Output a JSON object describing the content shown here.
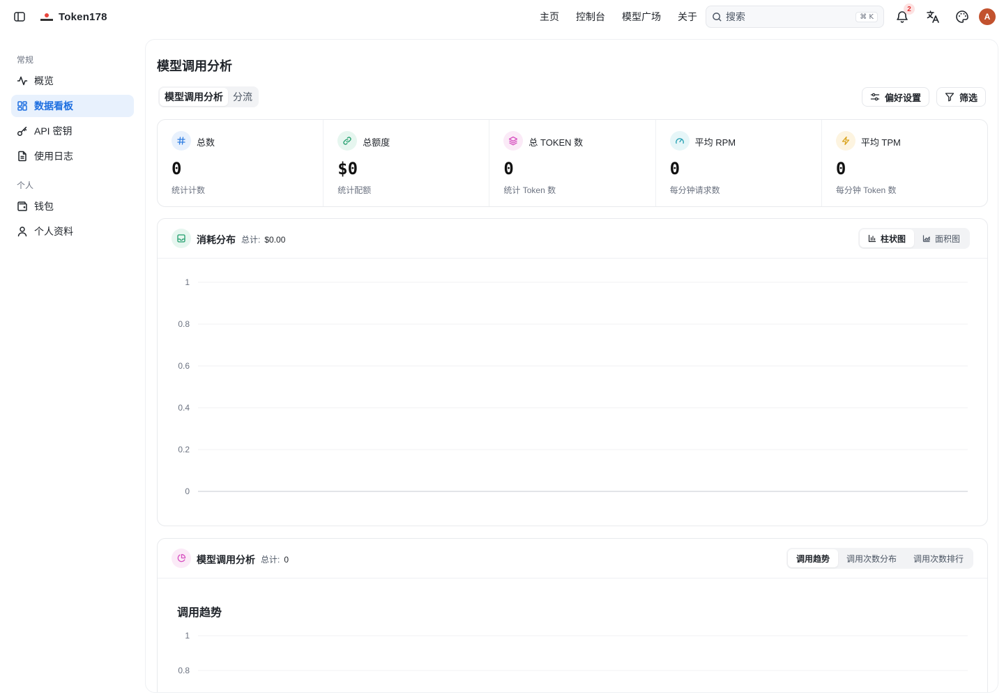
{
  "header": {
    "brand": "Token178",
    "nav": [
      "主页",
      "控制台",
      "模型广场",
      "关于"
    ],
    "search_placeholder": "搜索",
    "search_shortcut": "⌘ K",
    "notification_count": "2",
    "avatar_initial": "A"
  },
  "sidebar": {
    "sections": [
      {
        "title": "常规",
        "items": [
          {
            "label": "概览",
            "icon": "activity-icon",
            "active": false
          },
          {
            "label": "数据看板",
            "icon": "dashboard-icon",
            "active": true
          },
          {
            "label": "API 密钥",
            "icon": "key-icon",
            "active": false
          },
          {
            "label": "使用日志",
            "icon": "file-text-icon",
            "active": false
          }
        ]
      },
      {
        "title": "个人",
        "items": [
          {
            "label": "钱包",
            "icon": "wallet-icon",
            "active": false
          },
          {
            "label": "个人资料",
            "icon": "user-icon",
            "active": false
          }
        ]
      }
    ]
  },
  "main": {
    "title": "模型调用分析",
    "segments": [
      "模型调用分析",
      "分流"
    ],
    "active_segment": 0,
    "preferences_label": "偏好设置",
    "filter_label": "筛选",
    "stats": [
      {
        "label": "总数",
        "value": "0",
        "sub": "统计计数",
        "icon": "hash-icon",
        "color": "#2f7de1",
        "bg": "#e8f1fd"
      },
      {
        "label": "总额度",
        "value": "$0",
        "sub": "统计配额",
        "icon": "link-icon",
        "color": "#1f9d6b",
        "bg": "#e6f6ef"
      },
      {
        "label": "总 TOKEN 数",
        "value": "0",
        "sub": "统计 Token 数",
        "icon": "layers-icon",
        "color": "#d64fbf",
        "bg": "#fbeaf7"
      },
      {
        "label": "平均 RPM",
        "value": "0",
        "sub": "每分钟请求数",
        "icon": "gauge-icon",
        "color": "#1f9db0",
        "bg": "#e6f6f8"
      },
      {
        "label": "平均 TPM",
        "value": "0",
        "sub": "每分钟 Token 数",
        "icon": "zap-icon",
        "color": "#d9a21b",
        "bg": "#fdf4e0"
      }
    ],
    "consumption": {
      "title": "消耗分布",
      "total_label": "总计:",
      "total_value": "$0.00",
      "tabs": [
        "柱状图",
        "面积图"
      ],
      "active_tab": 0
    },
    "model_analysis": {
      "title": "模型调用分析",
      "total_label": "总计:",
      "total_value": "0",
      "tabs": [
        "调用趋势",
        "调用次数分布",
        "调用次数排行"
      ],
      "active_tab": 0,
      "subtitle": "调用趋势"
    }
  },
  "chart_data": [
    {
      "type": "bar",
      "title": "消耗分布",
      "categories": [],
      "series": [],
      "yticks": [
        "1",
        "0.8",
        "0.6",
        "0.4",
        "0.2",
        "0"
      ],
      "ylim": [
        0,
        1
      ],
      "grid": true
    },
    {
      "type": "line",
      "title": "调用趋势",
      "categories": [],
      "series": [],
      "yticks": [
        "1",
        "0.8"
      ],
      "ylim": [
        0,
        1
      ],
      "grid": true
    }
  ]
}
